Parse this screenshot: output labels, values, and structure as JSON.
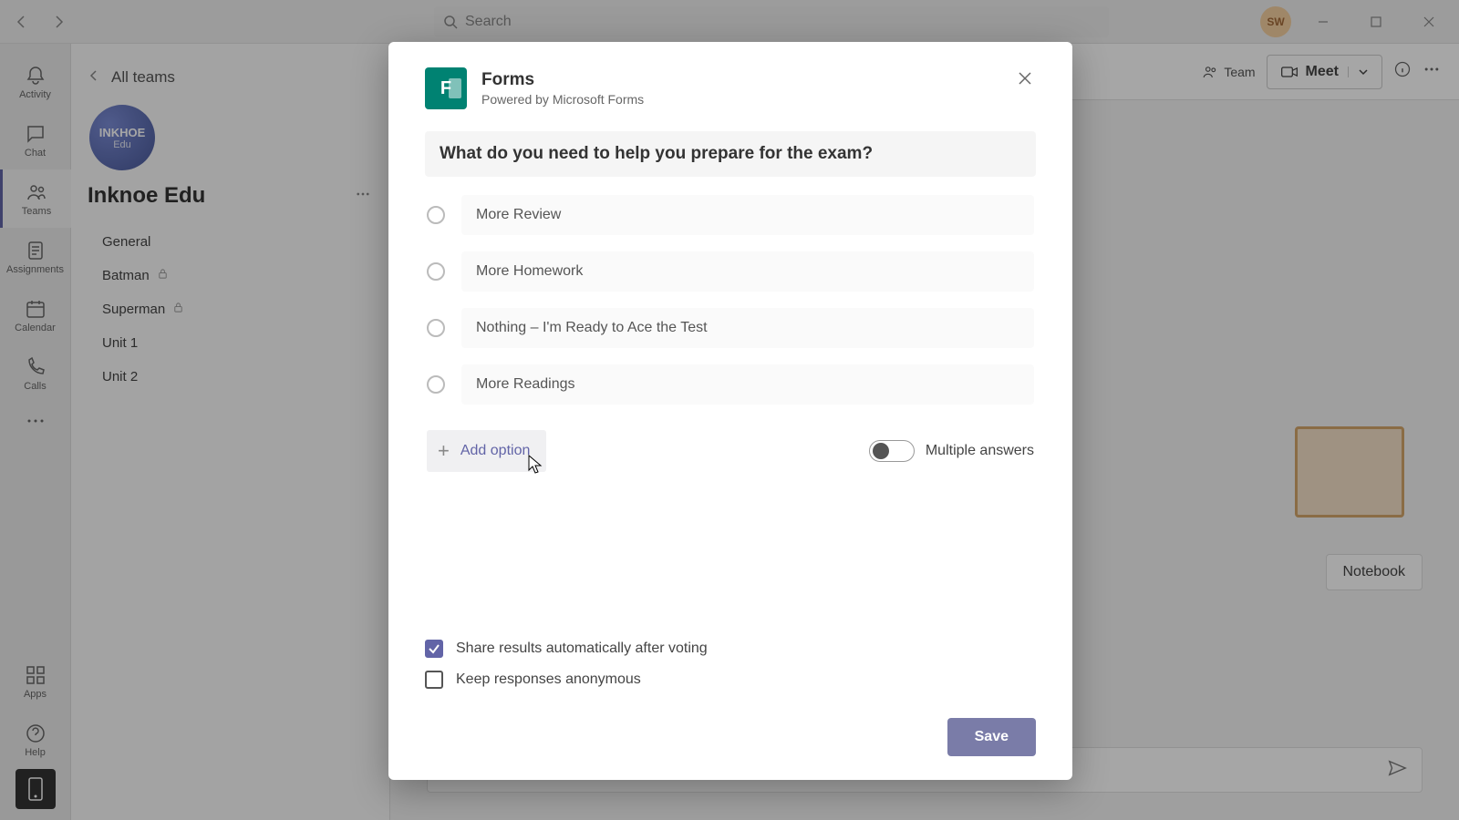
{
  "titlebar": {
    "search_placeholder": "Search",
    "avatar_initials": "SW"
  },
  "rail": {
    "items": [
      {
        "label": "Activity"
      },
      {
        "label": "Chat"
      },
      {
        "label": "Teams"
      },
      {
        "label": "Assignments"
      },
      {
        "label": "Calendar"
      },
      {
        "label": "Calls"
      }
    ],
    "apps_label": "Apps",
    "help_label": "Help"
  },
  "channel_panel": {
    "all_teams": "All teams",
    "team_logo_main": "INKHOE",
    "team_logo_sub": "Edu",
    "team_name": "Inknoe Edu",
    "channels": [
      {
        "label": "General",
        "locked": false
      },
      {
        "label": "Batman",
        "locked": true
      },
      {
        "label": "Superman",
        "locked": true
      },
      {
        "label": "Unit 1",
        "locked": false
      },
      {
        "label": "Unit 2",
        "locked": false
      }
    ]
  },
  "main_header": {
    "team_label": "Team",
    "meet_label": "Meet"
  },
  "notebook_label": "Notebook",
  "modal": {
    "title": "Forms",
    "subtitle": "Powered by Microsoft Forms",
    "question": "What do you need to help you prepare for the exam?",
    "options": [
      "More Review",
      "More Homework",
      "Nothing – I'm Ready to Ace the Test",
      "More Readings"
    ],
    "add_option_label": "Add option",
    "multiple_answers_label": "Multiple answers",
    "share_results_label": "Share results automatically after voting",
    "keep_anonymous_label": "Keep responses anonymous",
    "save_label": "Save"
  }
}
